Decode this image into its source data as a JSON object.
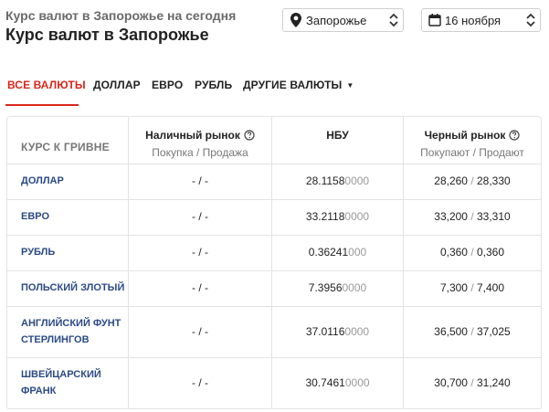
{
  "header": {
    "subtitle": "Курс валют в Запорожье на сегодня",
    "title": "Курс валют в Запорожье"
  },
  "filters": {
    "city": "Запорожье",
    "date": "16 ноября"
  },
  "tabs": [
    {
      "label": "ВСЕ ВАЛЮТЫ",
      "active": true
    },
    {
      "label": "ДОЛЛАР"
    },
    {
      "label": "ЕВРО"
    },
    {
      "label": "РУБЛЬ"
    },
    {
      "label": "ДРУГИЕ ВАЛЮТЫ"
    }
  ],
  "table": {
    "label": "КУРС К ГРИВНЕ",
    "columns": {
      "cash": {
        "title": "Наличный рынок",
        "sub": "Покупка / Продажа"
      },
      "nbu": {
        "title": "НБУ"
      },
      "black": {
        "title": "Черный рынок",
        "sub": "Покупают / Продают"
      }
    },
    "rows": [
      {
        "name": "ДОЛЛАР",
        "cash": "- / -",
        "nbu_main": "28.1158",
        "nbu_tail": "0000",
        "black_buy": "28,260",
        "black_sell": "28,330"
      },
      {
        "name": "ЕВРО",
        "cash": "- / -",
        "nbu_main": "33.2118",
        "nbu_tail": "0000",
        "black_buy": "33,200",
        "black_sell": "33,310"
      },
      {
        "name": "РУБЛЬ",
        "cash": "- / -",
        "nbu_main": "0.36241",
        "nbu_tail": "000",
        "black_buy": "0,360",
        "black_sell": "0,360"
      },
      {
        "name": "ПОЛЬСКИЙ ЗЛОТЫЙ",
        "cash": "- / -",
        "nbu_main": "7.3956",
        "nbu_tail": "0000",
        "black_buy": "7,300",
        "black_sell": "7,400"
      },
      {
        "name_line1": "АНГЛИЙСКИЙ ФУНТ",
        "name_line2": "СТЕРЛИНГОВ",
        "cash": "- / -",
        "nbu_main": "37.0116",
        "nbu_tail": "0000",
        "black_buy": "36,500",
        "black_sell": "37,025"
      },
      {
        "name_line1": "ШВЕЙЦАРСКИЙ",
        "name_line2": "ФРАНК",
        "cash": "- / -",
        "nbu_main": "30.7461",
        "nbu_tail": "0000",
        "black_buy": "30,700",
        "black_sell": "31,240"
      }
    ]
  }
}
